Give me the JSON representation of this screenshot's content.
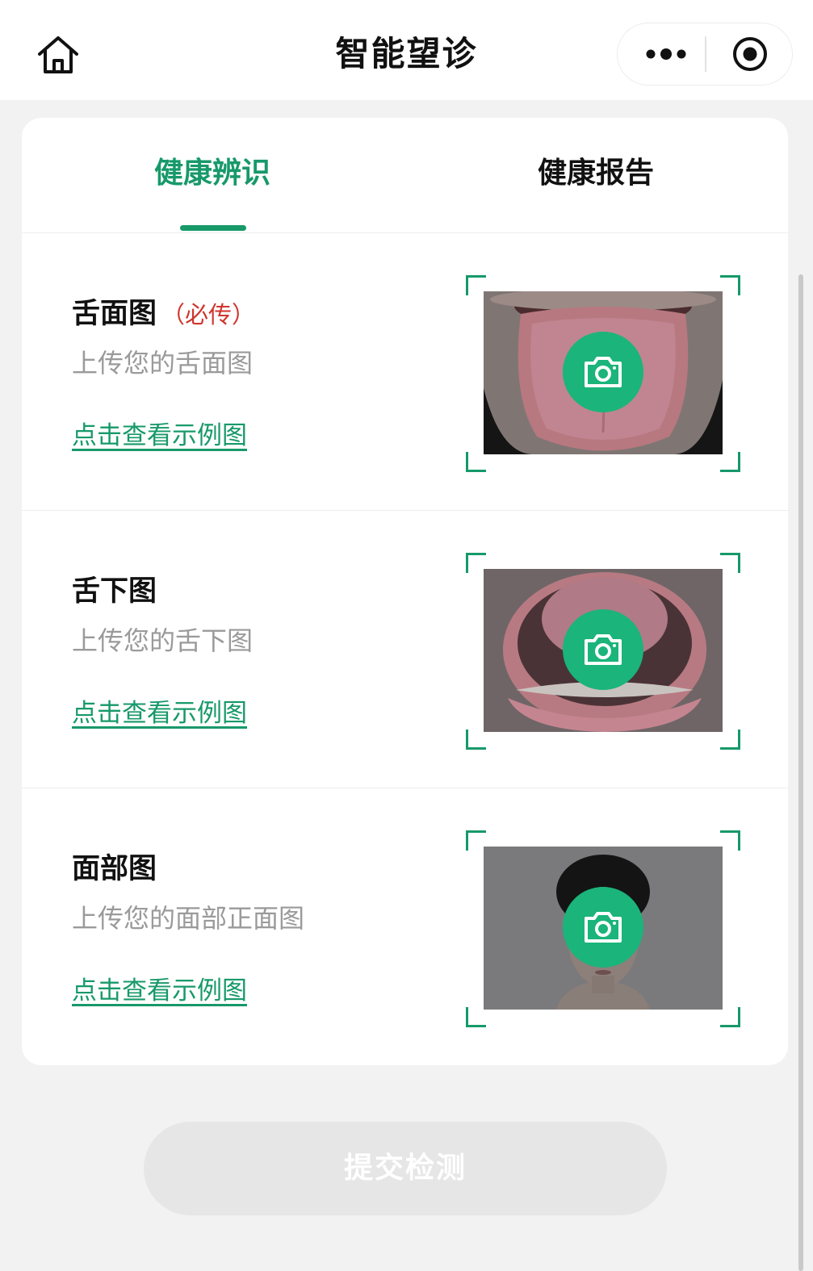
{
  "nav": {
    "title": "智能望诊",
    "home_icon": "home-icon",
    "more_icon": "more-dots-icon",
    "close_icon": "target-close-icon"
  },
  "tabs": [
    {
      "label": "健康辨识",
      "active": true
    },
    {
      "label": "健康报告",
      "active": false
    }
  ],
  "uploads": [
    {
      "title": "舌面图",
      "required_label": "（必传）",
      "subtitle": "上传您的舌面图",
      "link": "点击查看示例图",
      "icon": "camera-icon"
    },
    {
      "title": "舌下图",
      "required_label": "",
      "subtitle": "上传您的舌下图",
      "link": "点击查看示例图",
      "icon": "camera-icon"
    },
    {
      "title": "面部图",
      "required_label": "",
      "subtitle": "上传您的面部正面图",
      "link": "点击查看示例图",
      "icon": "camera-icon"
    }
  ],
  "submit": {
    "label": "提交检测",
    "enabled": false
  },
  "colors": {
    "accent": "#17996a",
    "camera_button": "#1bb47b",
    "required": "#d0352d",
    "subtitle": "#9a9a9a",
    "page_bg": "#f2f2f2",
    "submit_disabled_bg": "#e6e6e6"
  }
}
